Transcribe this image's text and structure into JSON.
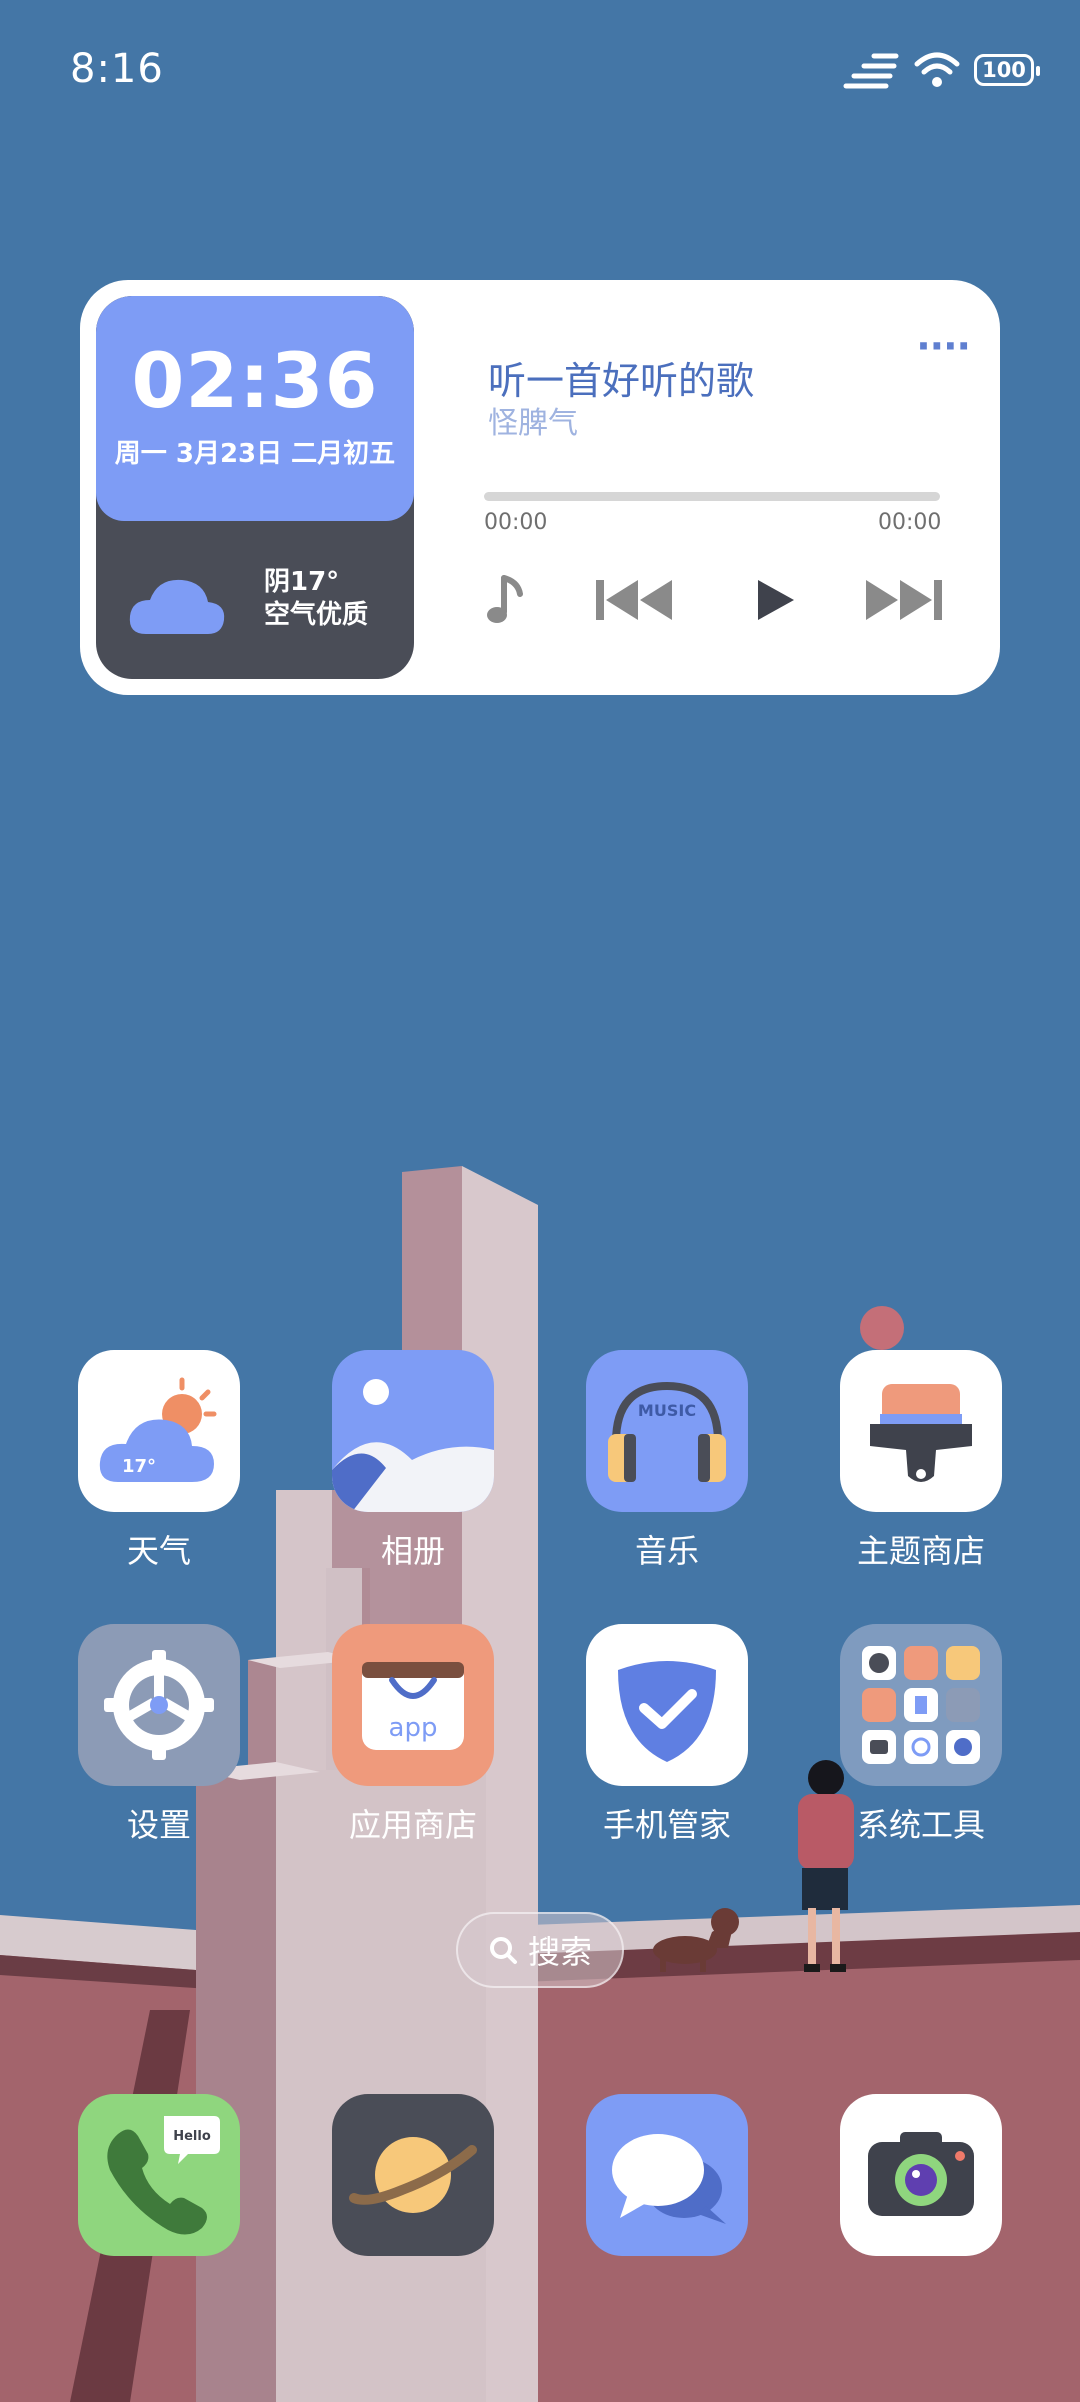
{
  "status_bar": {
    "time": "8:16",
    "battery": "100"
  },
  "widget": {
    "clock": {
      "time": "02:36",
      "date": "周一 3月23日 二月初五"
    },
    "weather": {
      "condition": "阴17°",
      "air_quality": "空气优质"
    },
    "music": {
      "title": "听一首好听的歌",
      "artist": "怪脾气",
      "elapsed": "00:00",
      "duration": "00:00",
      "progress": 0
    }
  },
  "apps": [
    {
      "label": "天气",
      "icon": "weather-icon",
      "icon_text": "17°"
    },
    {
      "label": "相册",
      "icon": "gallery-icon"
    },
    {
      "label": "音乐",
      "icon": "music-icon",
      "icon_text": "MUSIC"
    },
    {
      "label": "主题商店",
      "icon": "theme-store-icon"
    },
    {
      "label": "设置",
      "icon": "settings-icon"
    },
    {
      "label": "应用商店",
      "icon": "app-store-icon",
      "icon_text": "app"
    },
    {
      "label": "手机管家",
      "icon": "phone-manager-icon"
    },
    {
      "label": "系统工具",
      "icon": "system-tools-folder-icon"
    }
  ],
  "search": {
    "label": "搜索"
  },
  "dock": [
    {
      "icon": "phone-icon",
      "icon_text": "Hello"
    },
    {
      "icon": "browser-icon"
    },
    {
      "icon": "messages-icon"
    },
    {
      "icon": "camera-icon"
    }
  ],
  "colors": {
    "sky": "#4476a6",
    "widget_accent": "#7e9cf5",
    "widget_dark": "#4a4d57",
    "ground": "#a3646c",
    "tower": "#d6c5c9"
  }
}
